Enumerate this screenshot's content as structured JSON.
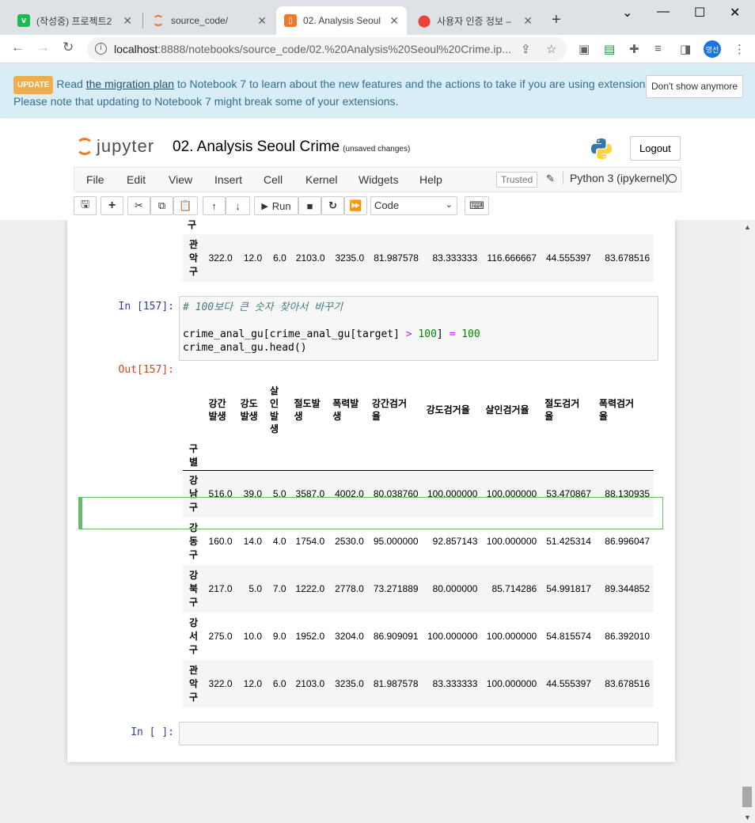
{
  "browser": {
    "tabs": [
      {
        "title": "(작성중) 프로젝트2",
        "icon": "v-icon",
        "color": "#1db954"
      },
      {
        "title": "source_code/",
        "icon": "jupyter-icon",
        "color": "#f37726"
      },
      {
        "title": "02. Analysis Seoul",
        "icon": "notebook-icon",
        "color": "#f37726"
      },
      {
        "title": "사용자 인증 정보 –",
        "icon": "maps-icon",
        "color": "#4285f4"
      }
    ],
    "url_host": "localhost",
    "url_path": ":8888/notebooks/source_code/02.%20Analysis%20Seoul%20Crime.ip...",
    "avatar_text": "영선"
  },
  "banner": {
    "badge": "UPDATE",
    "text_before": "Read ",
    "link": "the migration plan",
    "text_after": " to Notebook 7 to learn about the new features and the actions to take if you are using extensions -",
    "line2": "Please note that updating to Notebook 7 might break some of your extensions.",
    "dismiss": "Don't show anymore"
  },
  "header": {
    "brand": "jupyter",
    "title": "02. Analysis Seoul Crime",
    "checkpoint": "(unsaved changes)",
    "logout": "Logout"
  },
  "menu": {
    "items": [
      "File",
      "Edit",
      "View",
      "Insert",
      "Cell",
      "Kernel",
      "Widgets",
      "Help"
    ],
    "trusted": "Trusted",
    "kernel": "Python 3 (ipykernel)"
  },
  "toolbar": {
    "run": "Run",
    "cell_type": "Code"
  },
  "partial_row": {
    "index": "관악구",
    "values": [
      "322.0",
      "12.0",
      "6.0",
      "2103.0",
      "3235.0",
      "81.987578",
      "83.333333",
      "116.666667",
      "44.555397",
      "83.678516"
    ]
  },
  "cell_in": {
    "prompt": "In [157]:",
    "comment": "# 100보다 큰 숫자 찾아서 바꾸기",
    "line2_a": "crime_anal_gu[crime_anal_gu[target] ",
    "line2_op1": ">",
    "line2_b": " ",
    "line2_num1": "100",
    "line2_c": "] ",
    "line2_op2": "=",
    "line2_d": " ",
    "line2_num2": "100",
    "line3": "crime_anal_gu.head()"
  },
  "cell_out": {
    "prompt": "Out[157]:",
    "index_name": "구별",
    "columns": [
      "강간발생",
      "강도발생",
      "살인발생",
      "절도발생",
      "폭력발생",
      "강간검거율",
      "강도검거율",
      "살인검거율",
      "절도검거율",
      "폭력검거율"
    ],
    "rows": [
      {
        "index": "강남구",
        "values": [
          "516.0",
          "39.0",
          "5.0",
          "3587.0",
          "4002.0",
          "80.038760",
          "100.000000",
          "100.000000",
          "53.470867",
          "88.130935"
        ]
      },
      {
        "index": "강동구",
        "values": [
          "160.0",
          "14.0",
          "4.0",
          "1754.0",
          "2530.0",
          "95.000000",
          "92.857143",
          "100.000000",
          "51.425314",
          "86.996047"
        ]
      },
      {
        "index": "강북구",
        "values": [
          "217.0",
          "5.0",
          "7.0",
          "1222.0",
          "2778.0",
          "73.271889",
          "80.000000",
          "85.714286",
          "54.991817",
          "89.344852"
        ]
      },
      {
        "index": "강서구",
        "values": [
          "275.0",
          "10.0",
          "9.0",
          "1952.0",
          "3204.0",
          "86.909091",
          "100.000000",
          "100.000000",
          "54.815574",
          "86.392010"
        ]
      },
      {
        "index": "관악구",
        "values": [
          "322.0",
          "12.0",
          "6.0",
          "2103.0",
          "3235.0",
          "81.987578",
          "83.333333",
          "100.000000",
          "44.555397",
          "83.678516"
        ]
      }
    ]
  },
  "empty_cell": {
    "prompt": "In [ ]:"
  }
}
